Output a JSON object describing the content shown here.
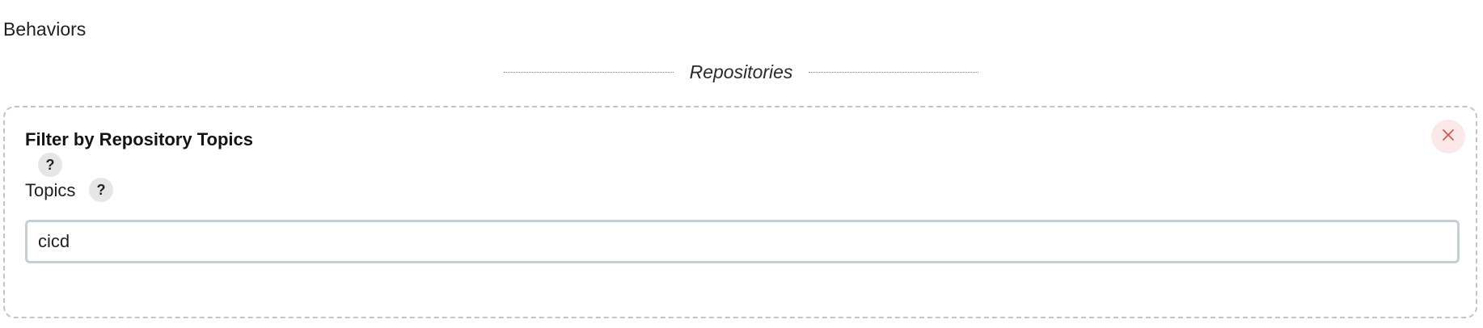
{
  "section": {
    "title": "Behaviors"
  },
  "divider": {
    "label": "Repositories"
  },
  "card": {
    "title": "Filter by Repository Topics",
    "help_label": "?",
    "close_icon": "close-icon",
    "close_color": "#d9534f",
    "field": {
      "label": "Topics",
      "help_label": "?",
      "value": "cicd"
    }
  }
}
